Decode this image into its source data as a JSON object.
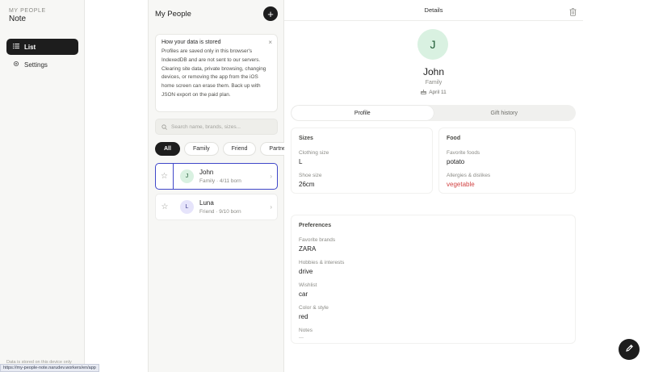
{
  "brand": {
    "kicker": "MY PEOPLE",
    "title": "Note"
  },
  "nav": {
    "list": "List",
    "settings": "Settings"
  },
  "sidebar_footer": "Data is stored on this device only",
  "list_panel": {
    "title": "My People",
    "notice_title": "How your data is stored",
    "notice_body": "Profiles are saved only in this browser's IndexedDB and are not sent to our servers. Clearing site data, private browsing, changing devices, or removing the app from the iOS home screen can erase them. Back up with JSON export on the paid plan.",
    "search_placeholder": "Search name, brands, sizes...",
    "chips": [
      "All",
      "Family",
      "Friend",
      "Partner",
      ""
    ],
    "people": [
      {
        "initial": "J",
        "name": "John",
        "sub": "Family · 4/11 born",
        "avatar_bg": "#d9f1e1",
        "avatar_fg": "#1f5a34"
      },
      {
        "initial": "L",
        "name": "Luna",
        "sub": "Friend · 9/10 born",
        "avatar_bg": "#e6e4fb",
        "avatar_fg": "#3d3a8a"
      }
    ]
  },
  "details": {
    "header": "Details",
    "initial": "J",
    "name": "John",
    "relation": "Family",
    "birthday": "April 11",
    "tabs": [
      "Profile",
      "Gift history"
    ],
    "sizes": {
      "title": "Sizes",
      "clothing_label": "Clothing size",
      "clothing_value": "L",
      "shoe_label": "Shoe size",
      "shoe_value": "26cm"
    },
    "food": {
      "title": "Food",
      "favorite_label": "Favorite foods",
      "favorite_value": "potato",
      "allergy_label": "Allergies & dislikes",
      "allergy_value": "vegetable"
    },
    "preferences": {
      "title": "Preferences",
      "brands_label": "Favorite brands",
      "brands_value": "ZARA",
      "hobbies_label": "Hobbies & interests",
      "hobbies_value": "drive",
      "wishlist_label": "Wishlist",
      "wishlist_value": "car",
      "color_label": "Color & style",
      "color_value": "red",
      "notes_label": "Notes",
      "notes_value": "—"
    }
  },
  "status_url": "https://my-people-note.narudev.workers/en/app",
  "colors": {
    "accent": "#1d1d1d",
    "selection": "#3f47c9",
    "warning": "#d24545"
  }
}
